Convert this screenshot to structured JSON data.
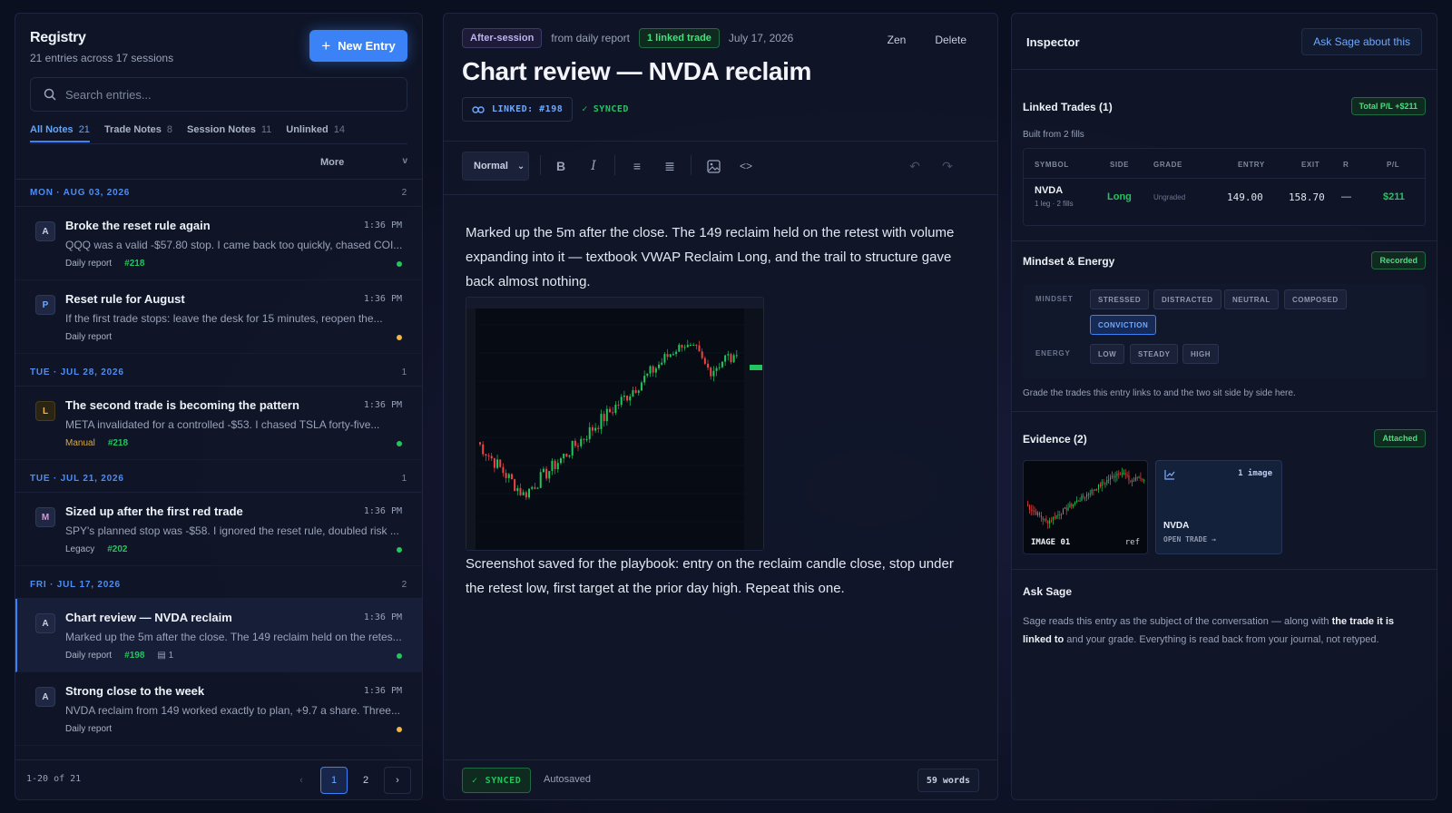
{
  "registry": {
    "title": "Registry",
    "subtitle": "21 entries across 17 sessions",
    "new_entry_label": "New Entry",
    "search_placeholder": "Search entries...",
    "tabs": [
      {
        "label": "All Notes",
        "count": "21"
      },
      {
        "label": "Trade Notes",
        "count": "8"
      },
      {
        "label": "Session Notes",
        "count": "11"
      },
      {
        "label": "Unlinked",
        "count": "14"
      }
    ],
    "more_label": "More",
    "groups": [
      {
        "day": "MON · AUG 03, 2026",
        "count": "2"
      },
      {
        "day": "TUE · JUL 28, 2026",
        "count": "1"
      },
      {
        "day": "TUE · JUL 21, 2026",
        "count": "1"
      },
      {
        "day": "FRI · JUL 17, 2026",
        "count": "2"
      }
    ],
    "entries": [
      {
        "avatar": "A",
        "title": "Broke the reset rule again",
        "time": "1:36 PM",
        "snippet": "QQQ was a valid -$57.80 stop. I came back too quickly, chased COI...",
        "source": "Daily report",
        "tag": "#218",
        "status": "green"
      },
      {
        "avatar": "P",
        "title": "Reset rule for August",
        "time": "1:36 PM",
        "snippet": "If the first trade stops: leave the desk for 15 minutes, reopen the...",
        "source": "Daily report",
        "tag": "",
        "status": "yellow"
      },
      {
        "avatar": "L",
        "title": "The second trade is becoming the pattern",
        "time": "1:36 PM",
        "snippet": "META invalidated for a controlled -$53. I chased TSLA forty-five...",
        "source": "Manual",
        "tag": "#218",
        "status": "green"
      },
      {
        "avatar": "M",
        "title": "Sized up after the first red trade",
        "time": "1:36 PM",
        "snippet": "SPY's planned stop was -$58. I ignored the reset rule, doubled risk ...",
        "source": "Legacy",
        "tag": "#202",
        "status": "green"
      },
      {
        "avatar": "A",
        "title": "Chart review — NVDA reclaim",
        "time": "1:36 PM",
        "snippet": "Marked up the 5m after the close. The 149 reclaim held on the retes...",
        "source": "Daily report",
        "tag": "#198",
        "attachments": "1",
        "status": "green"
      },
      {
        "avatar": "A",
        "title": "Strong close to the week",
        "time": "1:36 PM",
        "snippet": "NVDA reclaim from 149 worked exactly to plan, +9.7 a share. Three...",
        "source": "Daily report",
        "tag": "",
        "status": "yellow"
      }
    ],
    "pager": {
      "range": "1-20 of 21",
      "pages": [
        "1",
        "2"
      ]
    }
  },
  "editor": {
    "session_badge": "After-session",
    "from_label": "from daily report",
    "linked_badge": "1 linked trade",
    "date": "July 17, 2026",
    "zen_label": "Zen",
    "delete_label": "Delete",
    "title": "Chart review — NVDA reclaim",
    "linked_chip": "LINKED: #198",
    "synced_chip": "SYNCED",
    "format_select": "Normal",
    "paragraph1": "Marked up the 5m after the close. The 149 reclaim held on the retest with volume expanding into it — textbook VWAP Reclaim Long, and the trail to structure gave back almost nothing.",
    "paragraph2": "Screenshot saved for the playbook: entry on the reclaim candle close, stop under the retest low, first target at the prior day high. Repeat this one.",
    "footer_synced": "SYNCED",
    "autosaved": "Autosaved",
    "word_count": "59 words"
  },
  "inspector": {
    "title": "Inspector",
    "ask_button": "Ask Sage about this",
    "linked_trades": {
      "title": "Linked Trades (1)",
      "total_badge": "Total P/L +$211",
      "built_from": "Built from 2 fills",
      "headers": [
        "SYMBOL",
        "SIDE",
        "GRADE",
        "ENTRY",
        "EXIT",
        "R",
        "P/L"
      ],
      "row": {
        "symbol": "NVDA",
        "legs": "1 leg · 2 fills",
        "side": "Long",
        "grade": "Ungraded",
        "entry": "149.00",
        "exit": "158.70",
        "r": "—",
        "pl": "$211"
      }
    },
    "mindset": {
      "title": "Mindset & Energy",
      "badge": "Recorded",
      "mindset_label": "MINDSET",
      "mindset_options": [
        "STRESSED",
        "DISTRACTED",
        "NEUTRAL",
        "COMPOSED",
        "CONVICTION"
      ],
      "mindset_selected": "CONVICTION",
      "energy_label": "ENERGY",
      "energy_options": [
        "LOW",
        "STEADY",
        "HIGH"
      ],
      "hint": "Grade the trades this entry links to and the two sit side by side here."
    },
    "evidence": {
      "title": "Evidence (2)",
      "badge": "Attached",
      "image_label": "IMAGE 01",
      "image_ref": "ref",
      "card_count": "1 image",
      "card_symbol": "NVDA",
      "card_action": "OPEN TRADE"
    },
    "ask_sage": {
      "title": "Ask Sage",
      "text_a": "Sage reads this entry as the subject of the conversation — along with ",
      "text_b": "the trade it is linked to",
      "text_c": " and your grade. Everything is read back from your journal, not retyped."
    }
  },
  "colors": {
    "accent": "#3b82f6",
    "positive": "#22c55e",
    "warning": "#f2b544",
    "background": "#0b1020"
  }
}
